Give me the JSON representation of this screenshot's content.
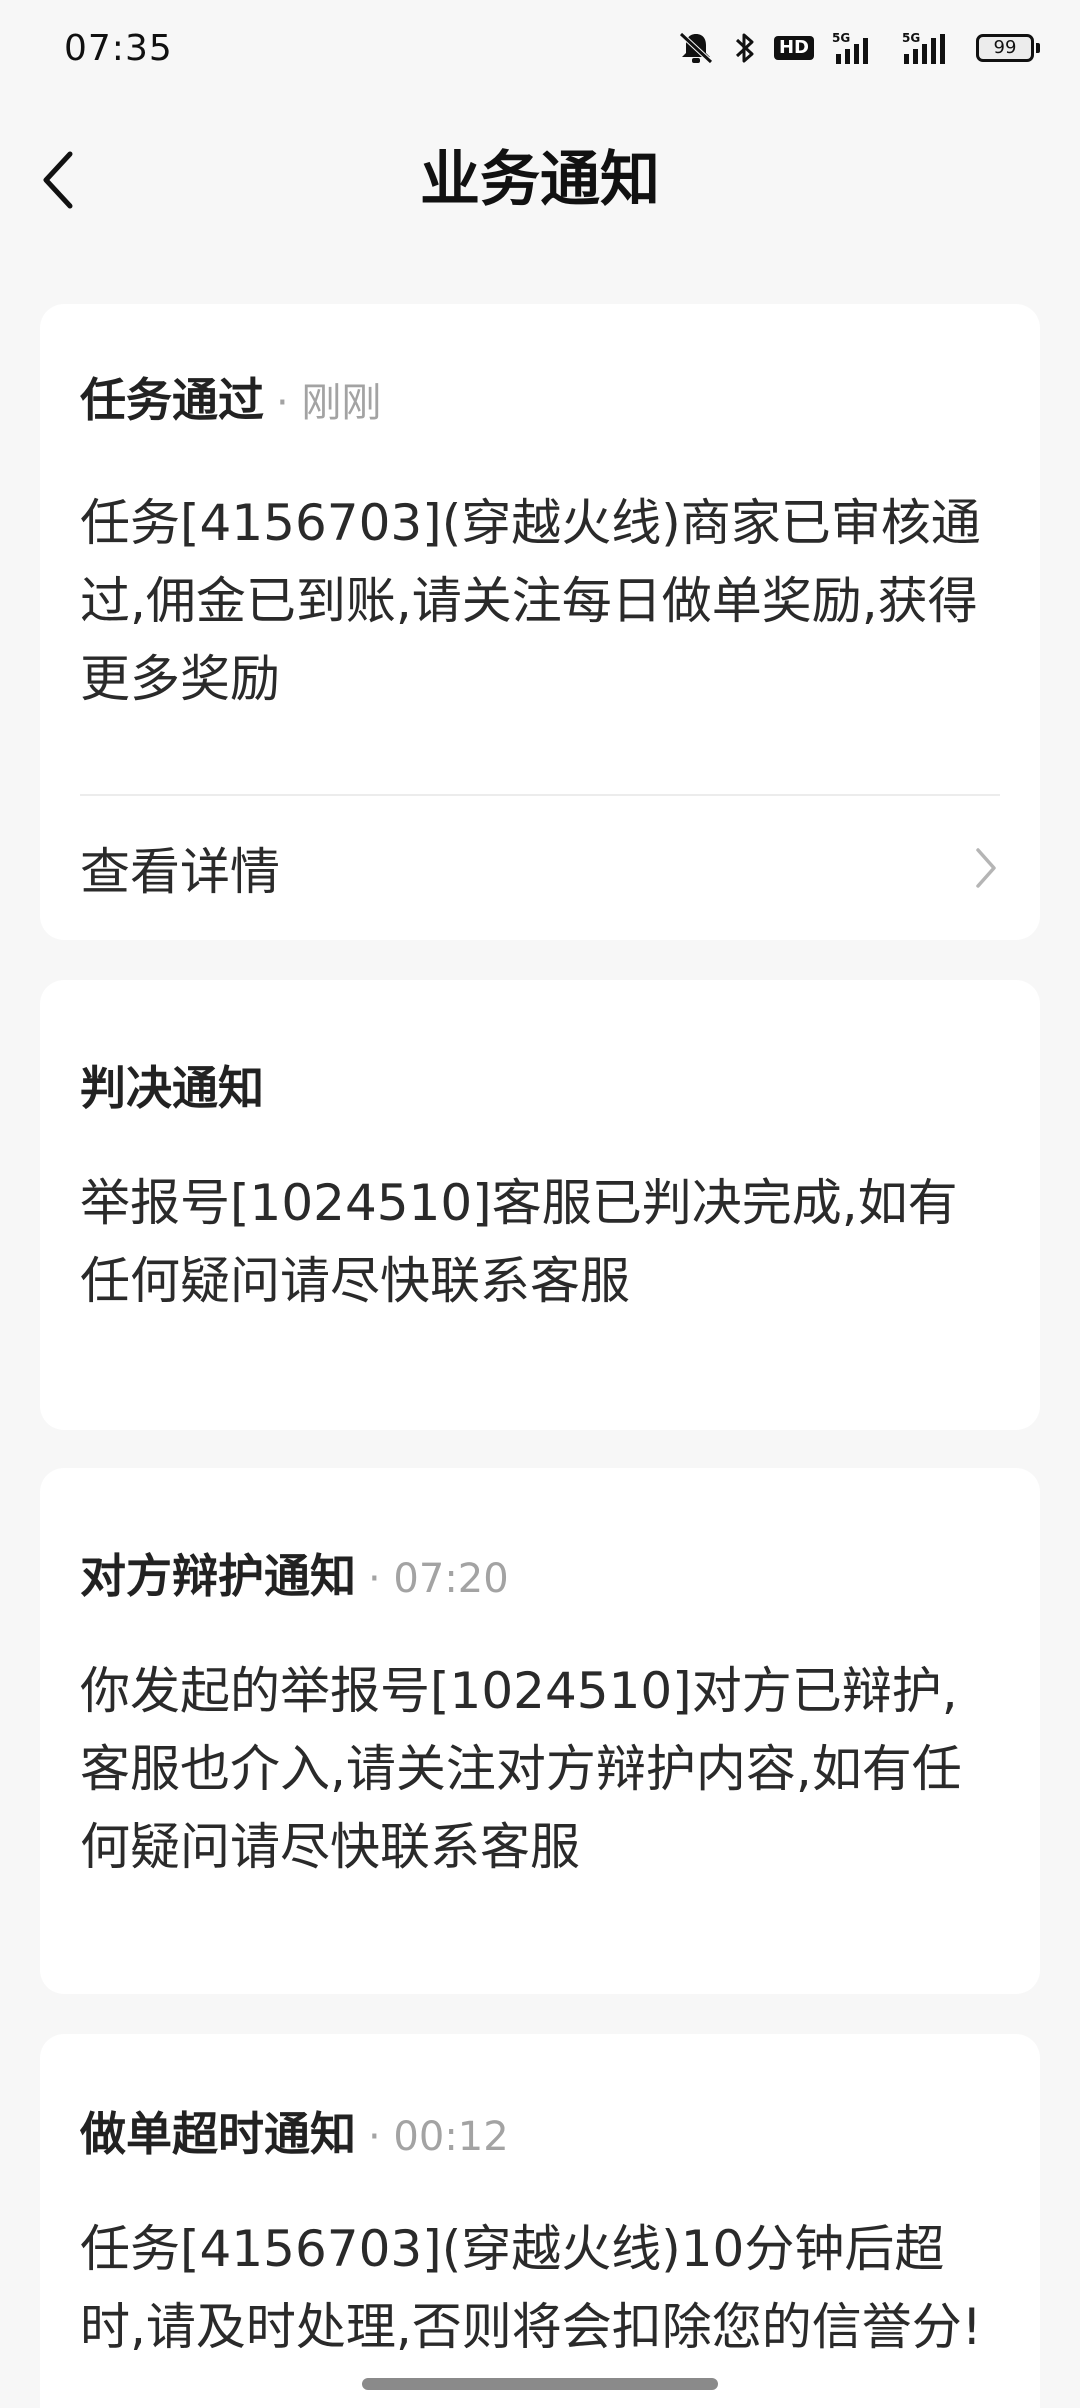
{
  "status_bar": {
    "time": "07:35",
    "hd_label": "HD",
    "network_1": "5G",
    "network_2": "5G",
    "battery": "99"
  },
  "header": {
    "title": "业务通知"
  },
  "notifications": [
    {
      "title": "任务通过",
      "time": "· 刚刚",
      "body": "任务[4156703](穿越火线)商家已审核通过,佣金已到账,请关注每日做单奖励,获得更多奖励",
      "detail_label": "查看详情"
    },
    {
      "title": "判决通知",
      "time": "",
      "body": "举报号[1024510]客服已判决完成,如有任何疑问请尽快联系客服"
    },
    {
      "title": "对方辩护通知",
      "time": "· 07:20",
      "body": "你发起的举报号[1024510]对方已辩护,客服也介入,请关注对方辩护内容,如有任何疑问请尽快联系客服"
    },
    {
      "title": "做单超时通知",
      "time": "· 00:12",
      "body": "任务[4156703](穿越火线)10分钟后超时,请及时处理,否则将会扣除您的信誉分!"
    }
  ]
}
